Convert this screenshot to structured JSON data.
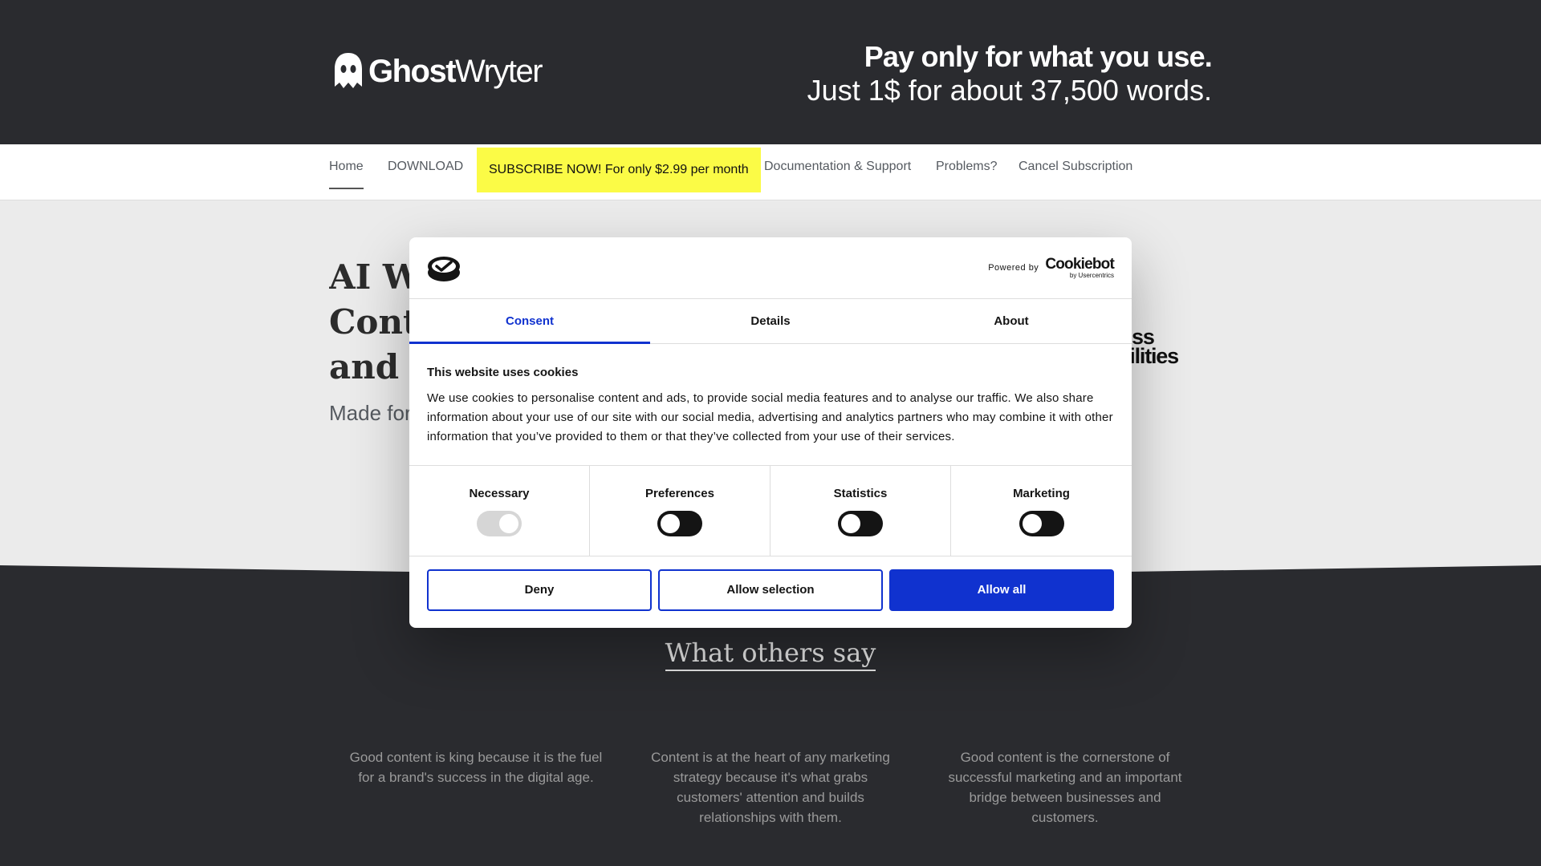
{
  "header": {
    "logo_bold": "Ghost",
    "logo_light": "Wryter",
    "tagline_line1": "Pay only for what you use.",
    "tagline_line2": "Just 1$ for about 37,500 words."
  },
  "nav": {
    "items": [
      {
        "label": "Home"
      },
      {
        "label": "DOWNLOAD"
      },
      {
        "label": "SUBSCRIBE NOW! For only $2.99 per month"
      },
      {
        "label": "Documentation & Support"
      },
      {
        "label": "Problems?"
      },
      {
        "label": "Cancel Subscription"
      }
    ]
  },
  "hero": {
    "title_line1": "AI Wr",
    "title_line2": "Conte",
    "title_line3": "and W",
    "subtitle": "Made for",
    "right_line1": "ss",
    "right_line2": "bilities"
  },
  "testimonials": {
    "title": "What others say",
    "quotes": [
      "Good content is king because it is the fuel for a brand's success in the digital age.",
      "Content is at the heart of any marketing strategy because it's what grabs customers' attention and builds relationships with them.",
      "Good content is the cornerstone of successful marketing and an important bridge between businesses and customers."
    ]
  },
  "cookie_dialog": {
    "powered_by": "Powered by",
    "brand_name": "Cookiebot",
    "brand_sub": "by Usercentrics",
    "tabs": [
      "Consent",
      "Details",
      "About"
    ],
    "active_tab": "Consent",
    "heading": "This website uses cookies",
    "text": "We use cookies to personalise content and ads, to provide social media features and to analyse our traffic. We also share information about your use of our site with our social media, advertising and analytics partners who may combine it with other information that you’ve provided to them or that they’ve collected from your use of their services.",
    "toggles": [
      {
        "label": "Necessary",
        "state": "on-disabled"
      },
      {
        "label": "Preferences",
        "state": "off"
      },
      {
        "label": "Statistics",
        "state": "off"
      },
      {
        "label": "Marketing",
        "state": "off"
      }
    ],
    "buttons": {
      "deny": "Deny",
      "allow_selection": "Allow selection",
      "allow_all": "Allow all"
    }
  },
  "colors": {
    "header_bg": "#2a2b2f",
    "accent_blue": "#1032cf",
    "subscribe_yellow": "#fbfb46"
  }
}
